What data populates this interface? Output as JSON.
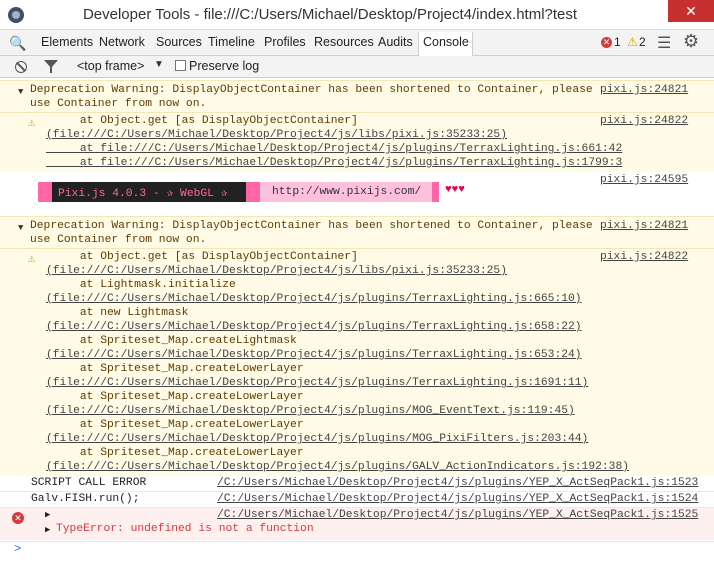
{
  "window": {
    "title": "Developer Tools - file:///C:/Users/Michael/Desktop/Project4/index.html?test",
    "close_glyph": "✕"
  },
  "tabs": [
    "Elements",
    "Network",
    "Sources",
    "Timeline",
    "Profiles",
    "Resources",
    "Audits",
    "Console"
  ],
  "active_tab": "Console",
  "status": {
    "error_count": "1",
    "warning_count": "2"
  },
  "toolbar": {
    "frame_label": "<top frame>",
    "preserve_log_label": "Preserve log",
    "preserve_log_checked": false
  },
  "console": {
    "warning1": {
      "line1": "Deprecation Warning: DisplayObjectContainer has been shortened to Container, please",
      "line2": "use Container from now on.",
      "source": "pixi.js:24821"
    },
    "trace1": {
      "source": "pixi.js:24822",
      "lines": [
        "     at Object.get [as DisplayObjectContainer]",
        "(file:///C:/Users/Michael/Desktop/Project4/js/libs/pixi.js:35233:25)",
        "     at file:///C:/Users/Michael/Desktop/Project4/js/plugins/TerraxLighting.js:661:42",
        "     at file:///C:/Users/Michael/Desktop/Project4/js/plugins/TerraxLighting.js:1799:3"
      ]
    },
    "banner": {
      "source": "pixi.js:24595",
      "left_text": "Pixi.js 4.0.3 - ✰ WebGL ✰",
      "url_text": "http://www.pixijs.com/",
      "hearts": "♥♥♥"
    },
    "warning2": {
      "line1": "Deprecation Warning: DisplayObjectContainer has been shortened to Container, please",
      "line2": "use Container from now on.",
      "source": "pixi.js:24821"
    },
    "trace2": {
      "source": "pixi.js:24822",
      "lines": [
        "     at Object.get [as DisplayObjectContainer]",
        "(file:///C:/Users/Michael/Desktop/Project4/js/libs/pixi.js:35233:25)",
        "     at Lightmask.initialize",
        "(file:///C:/Users/Michael/Desktop/Project4/js/plugins/TerraxLighting.js:665:10)",
        "     at new Lightmask",
        "(file:///C:/Users/Michael/Desktop/Project4/js/plugins/TerraxLighting.js:658:22)",
        "     at Spriteset_Map.createLightmask",
        "(file:///C:/Users/Michael/Desktop/Project4/js/plugins/TerraxLighting.js:653:24)",
        "     at Spriteset_Map.createLowerLayer",
        "(file:///C:/Users/Michael/Desktop/Project4/js/plugins/TerraxLighting.js:1691:11)",
        "     at Spriteset_Map.createLowerLayer",
        "(file:///C:/Users/Michael/Desktop/Project4/js/plugins/MOG_EventText.js:119:45)",
        "     at Spriteset_Map.createLowerLayer",
        "(file:///C:/Users/Michael/Desktop/Project4/js/plugins/MOG_PixiFilters.js:203:44)",
        "     at Spriteset_Map.createLowerLayer",
        "(file:///C:/Users/Michael/Desktop/Project4/js/plugins/GALV_ActionIndicators.js:192:38)"
      ]
    },
    "log1": {
      "text": "SCRIPT CALL ERROR",
      "source": "/C:/Users/Michael/Desktop/Project4/js/plugins/YEP_X_ActSeqPack1.js:1523"
    },
    "log2": {
      "text": "Galv.FISH.run();",
      "source": "/C:/Users/Michael/Desktop/Project4/js/plugins/YEP_X_ActSeqPack1.js:1524"
    },
    "error": {
      "source": "/C:/Users/Michael/Desktop/Project4/js/plugins/YEP_X_ActSeqPack1.js:1525",
      "message": "TypeError: undefined is not a function"
    },
    "prompt": ">"
  }
}
